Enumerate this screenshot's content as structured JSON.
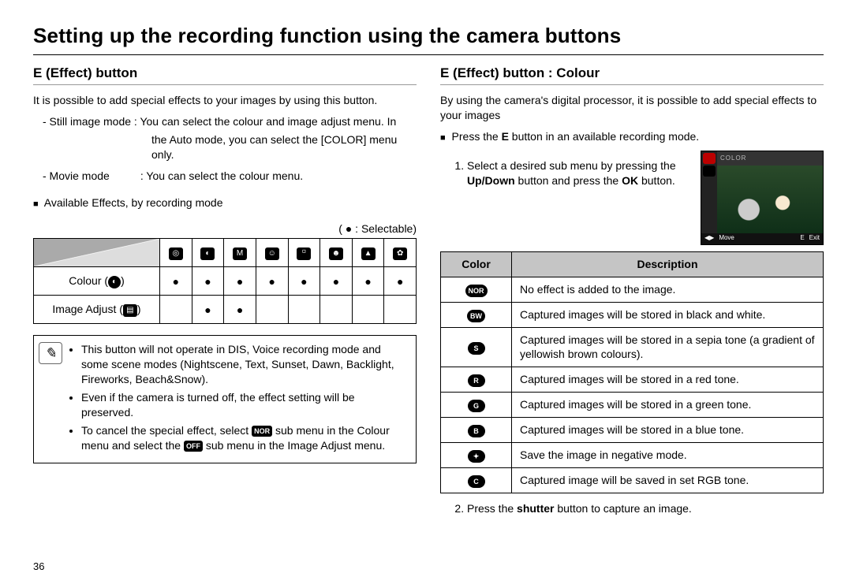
{
  "title": "Setting up the recording function using the camera buttons",
  "pagenum": "36",
  "left": {
    "heading": "E (Effect) button",
    "intro": "It is possible to add special effects to your images by using this button.",
    "mode_still_label": "- Still image mode :",
    "mode_still_text_a": "You can select the colour and image adjust menu. In",
    "mode_still_text_b": "the Auto mode, you can   select the [COLOR] menu",
    "mode_still_text_c": "only.",
    "mode_movie_label": "- Movie mode",
    "mode_movie_text": ": You can select the colour menu.",
    "avail_heading": "Available Effects, by recording mode",
    "legend": "( ● : Selectable)",
    "row_colour": "Colour (",
    "row_colour_suffix": ")",
    "row_image_adjust": "Image Adjust (",
    "row_image_adjust_suffix": ")",
    "note1": "This button will not operate in DIS, Voice recording mode and some scene modes (Nightscene, Text, Sunset, Dawn, Backlight, Fireworks, Beach&Snow).",
    "note2": "Even if the camera is turned off, the effect setting will be preserved.",
    "note3_a": "To cancel the special effect, select ",
    "note3_b": " sub menu in the Colour menu and select the ",
    "note3_c": " sub menu in the Image Adjust menu.",
    "nor_chip": "NOR",
    "off_chip": "OFF"
  },
  "right": {
    "heading": "E (Effect) button : Colour",
    "intro": "By using the camera's digital processor, it is possible to add special effects to your images",
    "press_e_a": "Press the ",
    "press_e_b": "E",
    "press_e_c": " button in an available recording mode.",
    "step1_a": "Select a desired sub menu by pressing the ",
    "step1_b": "Up/Down",
    "step1_c": " button and press the ",
    "step1_d": "OK",
    "step1_e": " button.",
    "scr_label": "COLOR",
    "scr_move": "Move",
    "scr_exit": "Exit",
    "th_color": "Color",
    "th_desc": "Description",
    "rows": [
      {
        "icon": "NOR",
        "desc": "No effect is added to the image."
      },
      {
        "icon": "BW",
        "desc": "Captured images will be stored in black and white."
      },
      {
        "icon": "S",
        "desc": "Captured images will be stored in a sepia tone (a gradient of yellowish brown colours)."
      },
      {
        "icon": "R",
        "desc": "Captured images will be stored in a red tone."
      },
      {
        "icon": "G",
        "desc": "Captured images will be stored in a green tone."
      },
      {
        "icon": "B",
        "desc": "Captured images will be stored in a blue tone."
      },
      {
        "icon": "✦",
        "desc": "Save the image in negative mode."
      },
      {
        "icon": "C",
        "desc": "Captured image will be saved in set RGB tone."
      }
    ],
    "step2_a": "Press the ",
    "step2_b": "shutter",
    "step2_c": " button to capture an image."
  }
}
